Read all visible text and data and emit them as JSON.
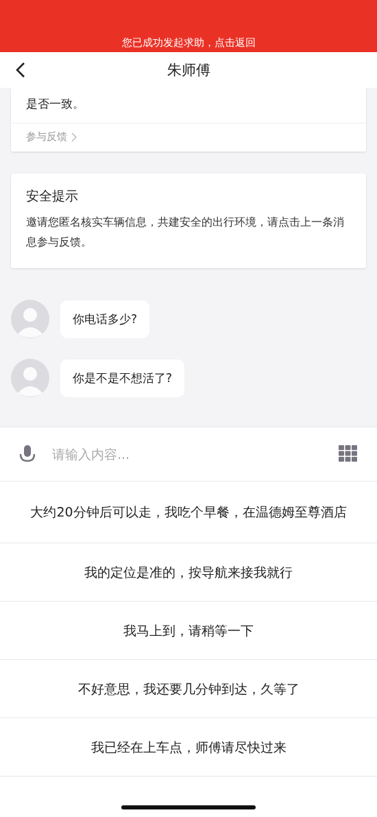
{
  "banner": {
    "text": "您已成功发起求助，点击返回"
  },
  "header": {
    "title": "朱师傅"
  },
  "notice_card": {
    "text": "是否一致。",
    "link": "参与反馈"
  },
  "safety_card": {
    "title": "安全提示",
    "text": "邀请您匿名核实车辆信息，共建安全的出行环境，请点击上一条消息参与反馈。"
  },
  "messages": [
    {
      "text": "你电话多少?"
    },
    {
      "text": "你是不是不想活了?"
    }
  ],
  "input": {
    "placeholder": "请输入内容..."
  },
  "quick_replies": [
    "大约20分钟后可以走，我吃个早餐，在温德姆至尊酒店",
    "我的定位是准的，按导航来接我就行",
    "我马上到，请稍等一下",
    "不好意思，我还要几分钟到达，久等了",
    "我已经在上车点，师傅请尽快过来"
  ]
}
